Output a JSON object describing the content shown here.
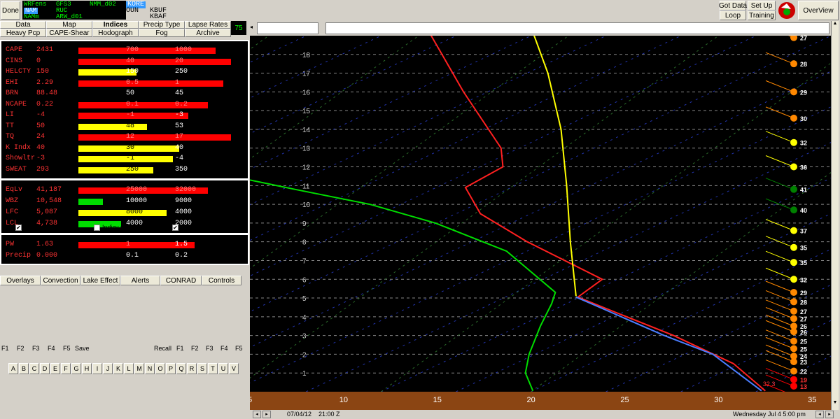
{
  "toolbar": {
    "done": "Done",
    "models": [
      {
        "name": "WRFens",
        "color": "#00ff00"
      },
      {
        "name": "GFS3",
        "color": "#00ff00"
      },
      {
        "name": "NMM_d02",
        "color": "#00ff00"
      },
      {
        "name": "NAM",
        "color": "#ffffff",
        "selected": true
      },
      {
        "name": "RUC",
        "color": "#00ff00"
      },
      {
        "name": "NAMm",
        "color": "#00ff00"
      },
      {
        "name": "ARW_d01",
        "color": "#00ff00"
      }
    ],
    "stations": [
      "KORE",
      "OUN",
      "KBUF",
      "KBAF"
    ],
    "got_data": "Got Data",
    "loop": "Loop",
    "set_up": "Set Up",
    "training": "Training",
    "overview": "OverView"
  },
  "tabs_row1": [
    "Data",
    "Map",
    "Indices",
    "Precip Type",
    "Lapse Rates"
  ],
  "tabs_row2": [
    "Heavy Pcp",
    "CAPE-Shear",
    "Hodograph",
    "Fog",
    "Archive"
  ],
  "timestep_box": "75",
  "indices": [
    {
      "label": "CAPE",
      "value": "2431",
      "bar_color": "#ff0000",
      "bar_fraction": 0.9,
      "q1": "700",
      "q2": "1000"
    },
    {
      "label": "CINS",
      "value": "0",
      "bar_color": "#ff0000",
      "bar_fraction": 1.0,
      "q1": "40",
      "q2": "20"
    },
    {
      "label": "HELCTY",
      "value": "150",
      "bar_color": "#ffff00",
      "bar_fraction": 0.38,
      "q1": "150",
      "q2": "250"
    },
    {
      "label": "EHI",
      "value": "2.29",
      "bar_color": "#ff0000",
      "bar_fraction": 0.95,
      "q1": "0.5",
      "q2": "1"
    },
    {
      "label": "BRN",
      "value": "88.48",
      "bar_color": "none",
      "bar_fraction": 0,
      "q1": "50",
      "q2": "45"
    },
    {
      "label": "NCAPE",
      "value": "0.22",
      "bar_color": "#ff0000",
      "bar_fraction": 0.85,
      "q1": "0.1",
      "q2": "0.2"
    },
    {
      "label": "LI",
      "value": "-4",
      "bar_color": "#ff0000",
      "bar_fraction": 0.72,
      "q1": "-1",
      "q2": "-3"
    },
    {
      "label": "TT",
      "value": "50",
      "bar_color": "#ffff00",
      "bar_fraction": 0.45,
      "q1": "48",
      "q2": "53"
    },
    {
      "label": "TQ",
      "value": "24",
      "bar_color": "#ff0000",
      "bar_fraction": 1.0,
      "q1": "12",
      "q2": "17"
    },
    {
      "label": "K Indx",
      "value": "40",
      "bar_color": "#ffff00",
      "bar_fraction": 0.66,
      "q1": "30",
      "q2": "40"
    },
    {
      "label": "Showltr",
      "value": "-3",
      "bar_color": "#ffff00",
      "bar_fraction": 0.62,
      "q1": "-1",
      "q2": "-4"
    },
    {
      "label": "SWEAT",
      "value": "293",
      "bar_color": "#ffff00",
      "bar_fraction": 0.49,
      "q1": "250",
      "q2": "350"
    }
  ],
  "indices2": [
    {
      "label": "EqLv",
      "value": "41,187",
      "bar_color": "#ff0000",
      "bar_fraction": 0.85,
      "q1": "25000",
      "q2": "32000"
    },
    {
      "label": "WBZ",
      "value": "10,548",
      "bar_color": "#00dd00",
      "bar_fraction": 0.16,
      "q1": "10000",
      "q2": "9000"
    },
    {
      "label": "LFC",
      "value": "5,087",
      "bar_color": "#ffff00",
      "bar_fraction": 0.58,
      "q1": "8000",
      "q2": "4000"
    },
    {
      "label": "LCL",
      "value": "4,738",
      "bar_color": "#00dd00",
      "bar_fraction": 0.28,
      "q1": "4000",
      "q2": "2000"
    }
  ],
  "indices3": [
    {
      "label": "PW",
      "value": "1.63",
      "bar_color": "#ff0000",
      "bar_fraction": 0.76,
      "q1": "1",
      "q2": "1.5"
    },
    {
      "label": "Precip",
      "value": "0.000",
      "bar_color": "none",
      "bar_fraction": 0,
      "q1": "0.1",
      "q2": "0.2"
    }
  ],
  "checkboxes": [
    {
      "label": "Indicy Bar",
      "checked": true
    },
    {
      "label": "Indicy Circle",
      "checked": false
    },
    {
      "label": "Quartile Box",
      "checked": true
    }
  ],
  "bottom_tabs": [
    "Overlays",
    "Convection",
    "Lake Effect",
    "Alerts",
    "CONRAD",
    "Controls"
  ],
  "fkeys_left": [
    "F1",
    "F2",
    "F3",
    "F4",
    "F5"
  ],
  "save_label": "Save",
  "recall_label": "Recall",
  "fkeys_right": [
    "F1",
    "F2",
    "F3",
    "F4",
    "F5"
  ],
  "alphabet": [
    "A",
    "B",
    "C",
    "D",
    "E",
    "F",
    "G",
    "H",
    "I",
    "J",
    "K",
    "L",
    "M",
    "N",
    "O",
    "P",
    "Q",
    "R",
    "S",
    "T",
    "U",
    "V"
  ],
  "chart_data": {
    "type": "line",
    "xlabel": "",
    "ylabel": "",
    "xlim": [
      5,
      36
    ],
    "ylim": [
      0,
      19
    ],
    "x_ticks": [
      5,
      10,
      15,
      20,
      25,
      30,
      35
    ],
    "y_ticks": [
      1,
      2,
      3,
      4,
      5,
      6,
      7,
      8,
      9,
      10,
      11,
      12,
      13,
      14,
      15,
      16,
      17,
      18
    ],
    "series": [
      {
        "color": "#ff2020",
        "points": [
          [
            14.1,
            20
          ],
          [
            16.4,
            16
          ],
          [
            18.4,
            13
          ],
          [
            18.5,
            12
          ],
          [
            16.5,
            10.9
          ],
          [
            17.3,
            9.5
          ],
          [
            19.8,
            8
          ],
          [
            23.8,
            6
          ],
          [
            22.5,
            5.05
          ],
          [
            24.6,
            4.2
          ],
          [
            27.6,
            3
          ],
          [
            30.8,
            1.5
          ],
          [
            32.5,
            0.05
          ]
        ]
      },
      {
        "color": "#ffff00",
        "points": [
          [
            19.8,
            20
          ],
          [
            20.9,
            17
          ],
          [
            21.6,
            14
          ],
          [
            21.9,
            11
          ],
          [
            22.1,
            8
          ],
          [
            22.4,
            5.1
          ]
        ]
      },
      {
        "color": "#00dd00",
        "points": [
          [
            5,
            11.3
          ],
          [
            7.4,
            10.8
          ],
          [
            11.4,
            10
          ],
          [
            14.9,
            9
          ],
          [
            18.7,
            7.5
          ],
          [
            21.3,
            5.3
          ],
          [
            21.1,
            4.7
          ],
          [
            20.5,
            3.5
          ],
          [
            19.9,
            2
          ],
          [
            19.7,
            1
          ],
          [
            20.1,
            0.05
          ]
        ]
      },
      {
        "color": "#4a7dff",
        "points": [
          [
            22.4,
            5.05
          ],
          [
            23.9,
            4.4
          ],
          [
            27.1,
            3
          ],
          [
            29.7,
            2
          ],
          [
            32.3,
            0.05
          ]
        ]
      }
    ],
    "annotation": {
      "text": "32.3",
      "x": 32.3,
      "y": 0.3
    },
    "wind_values": [
      {
        "y": 18.9,
        "speed": "27",
        "color": "#ff8800"
      },
      {
        "y": 17.5,
        "speed": "28",
        "color": "#ff8800"
      },
      {
        "y": 16.0,
        "speed": "29",
        "color": "#ff8800"
      },
      {
        "y": 14.6,
        "speed": "30",
        "color": "#ff8800"
      },
      {
        "y": 13.3,
        "speed": "32",
        "color": "#ffff00"
      },
      {
        "y": 12.0,
        "speed": "36",
        "color": "#ffff00"
      },
      {
        "y": 10.8,
        "speed": "41",
        "color": "#008000"
      },
      {
        "y": 9.7,
        "speed": "40",
        "color": "#008000"
      },
      {
        "y": 8.6,
        "speed": "37",
        "color": "#ffff00"
      },
      {
        "y": 7.7,
        "speed": "35",
        "color": "#ffff00"
      },
      {
        "y": 6.9,
        "speed": "35",
        "color": "#ffff00"
      },
      {
        "y": 6.0,
        "speed": "32",
        "color": "#ffff00"
      },
      {
        "y": 5.3,
        "speed": "29",
        "color": "#ff8800"
      },
      {
        "y": 4.8,
        "speed": "28",
        "color": "#ff8800"
      },
      {
        "y": 4.3,
        "speed": "27",
        "color": "#ff8800"
      },
      {
        "y": 3.9,
        "speed": "27",
        "color": "#ff8800"
      },
      {
        "y": 3.5,
        "speed": "26",
        "color": "#ff8800"
      },
      {
        "y": 3.2,
        "speed": "26",
        "color": "#ff8800"
      },
      {
        "y": 2.7,
        "speed": "25",
        "color": "#ff8800"
      },
      {
        "y": 2.3,
        "speed": "25",
        "color": "#ff8800"
      },
      {
        "y": 1.9,
        "speed": "24",
        "color": "#ff8800"
      },
      {
        "y": 1.6,
        "speed": "23",
        "color": "#ff8800"
      },
      {
        "y": 1.1,
        "speed": "22",
        "color": "#ff8800"
      },
      {
        "y": 0.65,
        "speed": "19",
        "color": "#ff0000"
      },
      {
        "y": 0.3,
        "speed": "13",
        "color": "#ff0000"
      },
      {
        "y": -0.2,
        "speed": "14",
        "color": "#ff0000"
      }
    ]
  },
  "status": {
    "date": "07/04/12",
    "time": "21:00 Z",
    "datetime": "Wednesday   Jul 4  5:00 pm"
  }
}
